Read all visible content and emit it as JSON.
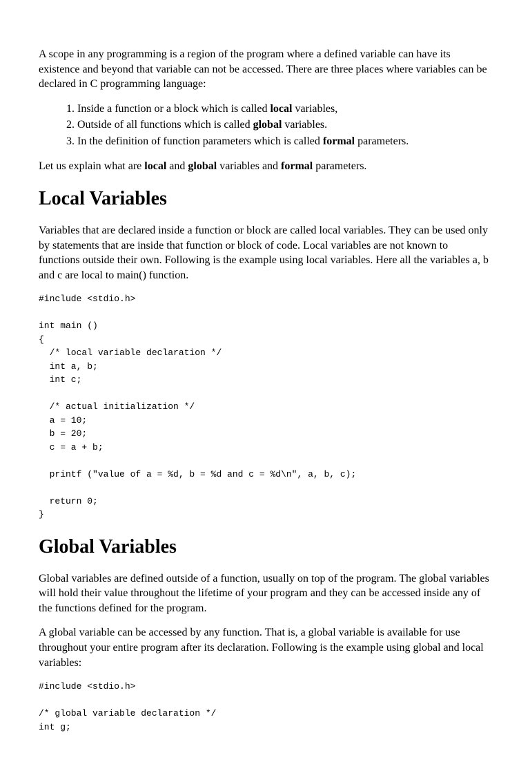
{
  "intro": {
    "p1_a": "A scope in any programming is a region of the program where a defined variable can have its existence and beyond that variable can not be accessed. There are three places where variables can be declared in C programming language:",
    "li1_a": "Inside a function or a block which is called ",
    "li1_b": "local",
    "li1_c": " variables,",
    "li2_a": "Outside of all functions which is called ",
    "li2_b": "global",
    "li2_c": " variables.",
    "li3_a": "In the definition of function parameters which is called ",
    "li3_b": "formal",
    "li3_c": " parameters.",
    "p2_a": "Let us explain what are ",
    "p2_b": "local",
    "p2_c": " and ",
    "p2_d": "global",
    "p2_e": " variables and ",
    "p2_f": "formal",
    "p2_g": " parameters."
  },
  "local": {
    "heading": "Local Variables",
    "p1": "Variables that are declared inside a function or block are called local variables. They can be used only by statements that are inside that function or block of code. Local variables are not known to functions outside their own. Following is the example using local variables. Here all the variables a, b and c are local to main() function.",
    "code": "#include <stdio.h>\n\nint main ()\n{\n  /* local variable declaration */\n  int a, b;\n  int c;\n\n  /* actual initialization */\n  a = 10;\n  b = 20;\n  c = a + b;\n\n  printf (\"value of a = %d, b = %d and c = %d\\n\", a, b, c);\n\n  return 0;\n}"
  },
  "global": {
    "heading": "Global Variables",
    "p1": "Global variables are defined outside of a function, usually on top of the program. The global variables will hold their value throughout the lifetime of your program and they can be accessed inside any of the functions defined for the program.",
    "p2": "A global variable can be accessed by any function. That is, a global variable is available for use throughout your entire program after its declaration. Following is the example using global and local variables:",
    "code": "#include <stdio.h>\n\n/* global variable declaration */\nint g;"
  }
}
